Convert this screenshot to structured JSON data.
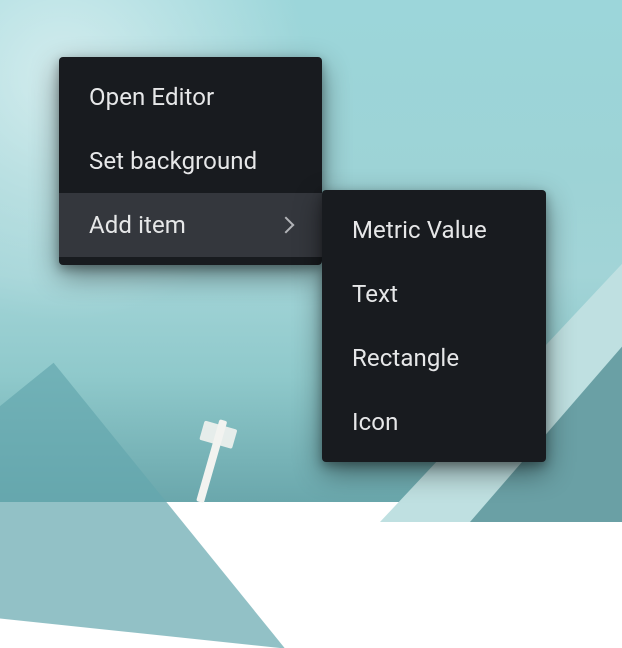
{
  "menu": {
    "items": [
      {
        "label": "Open Editor",
        "has_submenu": false
      },
      {
        "label": "Set background",
        "has_submenu": false
      },
      {
        "label": "Add item",
        "has_submenu": true,
        "hovered": true
      }
    ]
  },
  "submenu": {
    "items": [
      {
        "label": "Metric Value"
      },
      {
        "label": "Text"
      },
      {
        "label": "Rectangle"
      },
      {
        "label": "Icon"
      }
    ]
  },
  "colors": {
    "menu_bg": "#181b1f",
    "menu_hover": "#34373d",
    "menu_text": "#e6e7e8"
  }
}
